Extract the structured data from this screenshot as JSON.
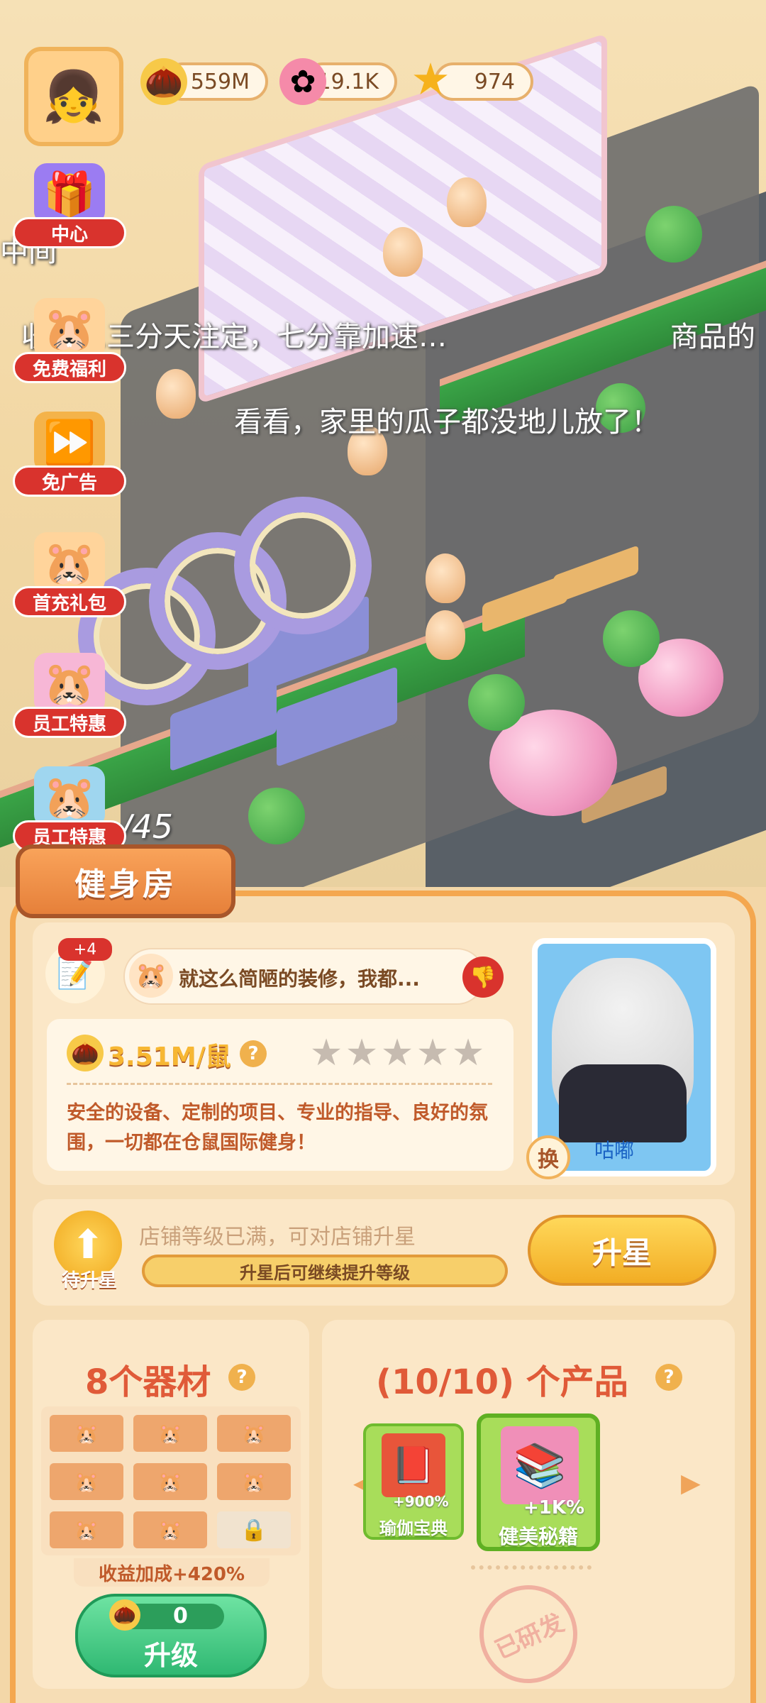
{
  "hud": {
    "resources": [
      {
        "icon": "seed-coin-icon",
        "value": "559M"
      },
      {
        "icon": "pink-flower-icon",
        "value": "19.1K"
      },
      {
        "icon": "gold-star-icon",
        "value": "974"
      }
    ]
  },
  "side_menu": [
    {
      "label": "中心"
    },
    {
      "label": "免费福利"
    },
    {
      "label": "免广告"
    },
    {
      "label": "首充礼包"
    },
    {
      "label": "员工特惠"
    },
    {
      "label": "员工特惠"
    }
  ],
  "scene_texts": {
    "bubble_1": "中间",
    "bubble_2": "收益…三分天注定，七分靠加速…",
    "bubble_3": "商品的",
    "bubble_4": "看看，家里的瓜子都没地儿放了！",
    "capacity_fragment": "/45"
  },
  "shop": {
    "title": "健身房",
    "comment_count": "+4",
    "review_text": "就这么简陋的装修，我都...",
    "income": "3.51M/鼠",
    "stars_filled": 0,
    "stars_total": 5,
    "description": "安全的设备、定制的项目、专业的指导、良好的氛围，一切都在仓鼠国际健身！",
    "staff_name": "咕嘟",
    "swap_label": "换"
  },
  "upgrade": {
    "badge_label": "待升星",
    "status_text": "店铺等级已满，可对店铺升星",
    "bar_text": "升星后可继续提升等级",
    "button_label": "升星"
  },
  "equipment": {
    "title": "8个器材",
    "bonus": "收益加成+420%",
    "cost": "0",
    "button_label": "升级"
  },
  "products": {
    "title": "(10/10) 个产品",
    "items": [
      {
        "name": "瑜伽宝典",
        "bonus": "+900%"
      },
      {
        "name": "健美秘籍",
        "bonus": "+1K%"
      }
    ],
    "stamp": "已研发"
  }
}
